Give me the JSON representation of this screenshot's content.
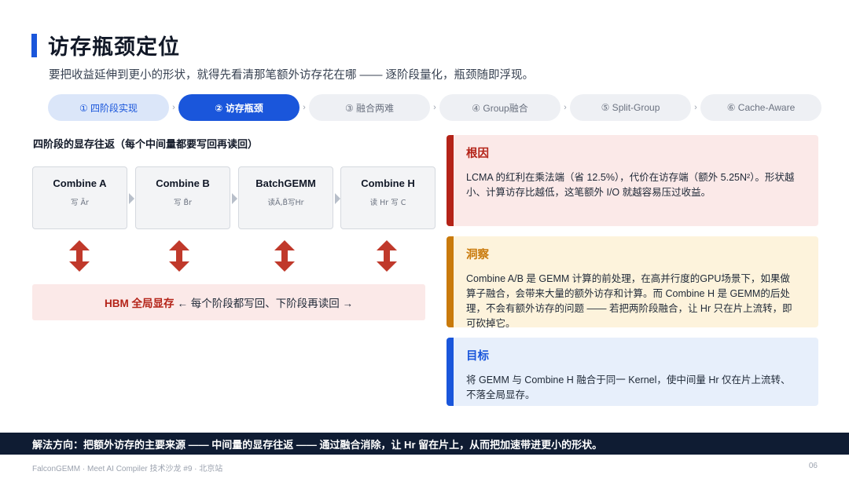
{
  "header": {
    "title": "访存瓶颈定位",
    "subtitle": "要把收益延伸到更小的形状，就得先看清那笔额外访存花在哪 —— 逐阶段量化，瓶颈随即浮现。"
  },
  "steps": [
    {
      "label": "① 四阶段实现",
      "state": "done"
    },
    {
      "label": "② 访存瓶颈",
      "state": "active"
    },
    {
      "label": "③ 融合两难",
      "state": "todo"
    },
    {
      "label": "④ Group融合",
      "state": "todo"
    },
    {
      "label": "⑤ Split-Group",
      "state": "todo"
    },
    {
      "label": "⑥ Cache-Aware",
      "state": "todo"
    }
  ],
  "step_separator": "›",
  "diagram": {
    "label": "四阶段的显存往返（每个中间量都要写回再读回）",
    "stages": [
      {
        "name": "Combine A",
        "desc": "写 Ãr"
      },
      {
        "name": "Combine B",
        "desc": "写 B̃r"
      },
      {
        "name": "BatchGEMM",
        "desc": "读Ã,B̃写Hr"
      },
      {
        "name": "Combine H",
        "desc": "读 Hr 写 C"
      }
    ],
    "hbm_strong": "HBM 全局显存",
    "hbm_rest": "← 每个阶段都写回、下阶段再读回 →"
  },
  "cards": {
    "root_cause": {
      "title": "根因",
      "body": "LCMA 的红利在乘法端（省 12.5%），代价在访存端（额外 5.25N²）。形状越小、计算访存比越低，这笔额外 I/O 就越容易压过收益。"
    },
    "insight": {
      "title": "洞察",
      "body": "Combine A/B 是 GEMM 计算的前处理，在高并行度的GPU场景下，如果做算子融合，会带来大量的额外访存和计算。而 Combine H 是 GEMM的后处理，不会有额外访存的问题 —— 若把两阶段融合，让 Hr 只在片上流转，即可砍掉它。"
    },
    "goal": {
      "title": "目标",
      "body": "将 GEMM 与 Combine H 融合于同一 Kernel，使中间量 Hr 仅在片上流转、不落全局显存。"
    }
  },
  "banner": "解法方向：把额外访存的主要来源 —— 中间量的显存往返 —— 通过融合消除，让 Hr 留在片上，从而把加速带进更小的形状。",
  "footer": {
    "left": "FalconGEMM · Meet AI Compiler 技术沙龙 #9 · 北京站",
    "page": "06"
  },
  "colors": {
    "accent": "#1a56db",
    "danger": "#b42318",
    "warning": "#c97a0b",
    "banner": "#0f1c33"
  },
  "icons": [
    "double-arrow-vertical-icon",
    "chevron-right-icon"
  ]
}
